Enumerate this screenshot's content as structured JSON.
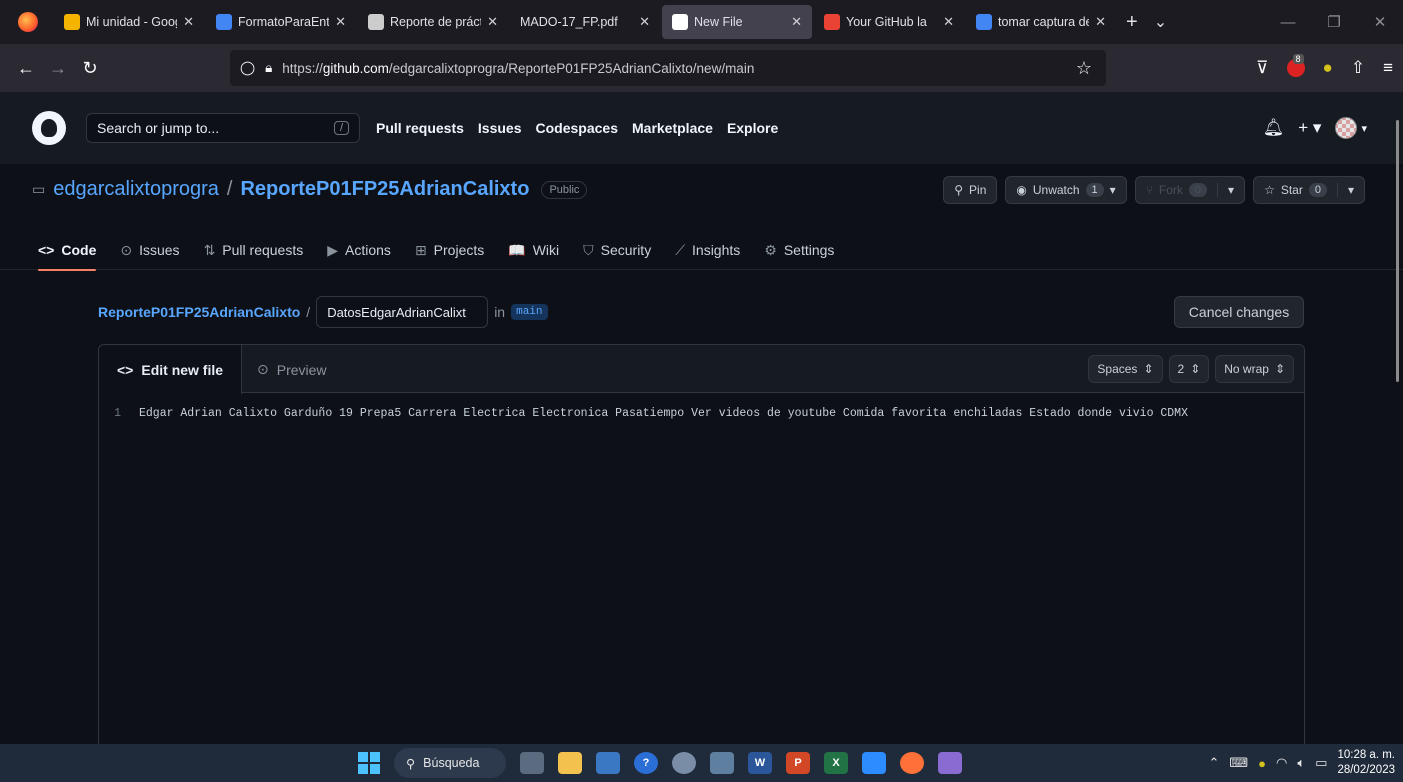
{
  "browser": {
    "tabs": [
      {
        "label": "Mi unidad - Goog",
        "favicon_color": "#f4b400",
        "active": false
      },
      {
        "label": "FormatoParaEntre",
        "favicon_color": "#4285f4",
        "active": false
      },
      {
        "label": "Reporte de práctic",
        "favicon_color": "#cccccc",
        "active": false
      },
      {
        "label": "MADO-17_FP.pdf",
        "favicon_color": "",
        "active": false
      },
      {
        "label": "New File",
        "favicon_color": "#ffffff",
        "active": true
      },
      {
        "label": "Your GitHub la",
        "favicon_color": "#ea4335",
        "active": false
      },
      {
        "label": "tomar captura de",
        "favicon_color": "#4285f4",
        "active": false
      }
    ],
    "new_tab_symbol": "+",
    "list_tabs_symbol": "⌄",
    "url_prefix": "https://",
    "url_domain": "github.com",
    "url_path": "/edgarcalixtoprogra/ReporteP01FP25AdrianCalixto/new/main",
    "extension_badge": "8"
  },
  "github": {
    "search_placeholder": "Search or jump to...",
    "search_shortcut": "/",
    "nav": [
      "Pull requests",
      "Issues",
      "Codespaces",
      "Marketplace",
      "Explore"
    ],
    "owner": "edgarcalixtoprogra",
    "repo": "ReporteP01FP25AdrianCalixto",
    "visibility": "Public",
    "actions": {
      "pin": "Pin",
      "unwatch": "Unwatch",
      "unwatch_count": "1",
      "fork": "Fork",
      "fork_count": "0",
      "star": "Star",
      "star_count": "0"
    },
    "repo_tabs": [
      {
        "label": "Code",
        "icon": "code-icon",
        "glyph": "<>",
        "active": true
      },
      {
        "label": "Issues",
        "icon": "issue-icon",
        "glyph": "⊙",
        "active": false
      },
      {
        "label": "Pull requests",
        "icon": "pull-request-icon",
        "glyph": "⇅",
        "active": false
      },
      {
        "label": "Actions",
        "icon": "play-icon",
        "glyph": "▶",
        "active": false
      },
      {
        "label": "Projects",
        "icon": "table-icon",
        "glyph": "⊞",
        "active": false
      },
      {
        "label": "Wiki",
        "icon": "book-icon",
        "glyph": "📖",
        "active": false
      },
      {
        "label": "Security",
        "icon": "shield-icon",
        "glyph": "⛉",
        "active": false
      },
      {
        "label": "Insights",
        "icon": "graph-icon",
        "glyph": "⟋",
        "active": false
      },
      {
        "label": "Settings",
        "icon": "gear-icon",
        "glyph": "⚙",
        "active": false
      }
    ],
    "editor": {
      "breadcrumb_repo": "ReporteP01FP25AdrianCalixto",
      "breadcrumb_sep": "/",
      "filename_value": "DatosEdgarAdrianCalixt",
      "in_label": "in",
      "branch": "main",
      "cancel_label": "Cancel changes",
      "tab_edit": "Edit new file",
      "tab_preview": "Preview",
      "indent_mode": "Spaces",
      "indent_size": "2",
      "wrap_mode": "No wrap",
      "line_number": "1",
      "line_text": "Edgar Adrian Calixto Garduño 19 Prepa5 Carrera Electrica Electronica Pasatiempo Ver videos de youtube Comida favorita enchiladas Estado donde vivio CDMX"
    }
  },
  "taskbar": {
    "search_label": "Búsqueda",
    "time": "10:28 a. m.",
    "date": "28/02/2023"
  }
}
